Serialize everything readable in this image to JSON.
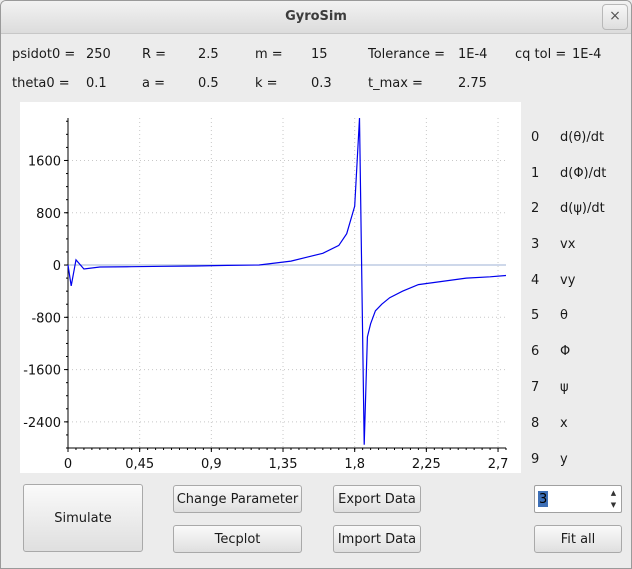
{
  "window": {
    "title": "GyroSim",
    "close_icon": "×"
  },
  "params": [
    {
      "label": "psidot0 =",
      "value": "250"
    },
    {
      "label": "R =",
      "value": "2.5"
    },
    {
      "label": "m =",
      "value": "15"
    },
    {
      "label": "Tolerance =",
      "value": "1E-4"
    },
    {
      "label": "cq tol =",
      "value": "1E-4"
    },
    {
      "label": "theta0 =",
      "value": "0.1"
    },
    {
      "label": "a =",
      "value": "0.5"
    },
    {
      "label": "k =",
      "value": "0.3"
    },
    {
      "label": "t_max =",
      "value": "2.75"
    }
  ],
  "channels": [
    {
      "num": "0",
      "name": "d(θ)/dt"
    },
    {
      "num": "1",
      "name": "d(Φ)/dt"
    },
    {
      "num": "2",
      "name": "d(ψ)/dt"
    },
    {
      "num": "3",
      "name": "vx"
    },
    {
      "num": "4",
      "name": "vy"
    },
    {
      "num": "5",
      "name": "θ"
    },
    {
      "num": "6",
      "name": "Φ"
    },
    {
      "num": "7",
      "name": "ψ"
    },
    {
      "num": "8",
      "name": "x"
    },
    {
      "num": "9",
      "name": "y"
    }
  ],
  "buttons": {
    "simulate": "Simulate",
    "change_parameter": "Change Parameter",
    "tecplot": "Tecplot",
    "export_data": "Export Data",
    "import_data": "Import Data",
    "fit_all": "Fit all"
  },
  "spinbox": {
    "value": "3"
  },
  "chart_data": {
    "type": "line",
    "title": "",
    "xlabel": "",
    "ylabel": "",
    "xlim": [
      0,
      2.75
    ],
    "ylim": [
      -2800,
      2250
    ],
    "x_ticks": [
      "0",
      "0,45",
      "0,9",
      "1,35",
      "1,8",
      "2,25",
      "2,7"
    ],
    "x_tick_values": [
      0,
      0.45,
      0.9,
      1.35,
      1.8,
      2.25,
      2.7
    ],
    "y_ticks": [
      "1600",
      "800",
      "0",
      "-800",
      "-1600",
      "-2400"
    ],
    "y_tick_values": [
      1600,
      800,
      0,
      -800,
      -1600,
      -2400
    ],
    "grid": true,
    "line_color": "#0000ee",
    "zero_line_color": "#9db2d6",
    "series": [
      {
        "x": [
          0,
          0.02,
          0.05,
          0.1,
          0.2,
          0.4,
          0.6,
          0.8,
          1.0,
          1.2,
          1.4,
          1.5,
          1.6,
          1.7,
          1.75,
          1.8,
          1.83,
          1.86,
          1.88,
          1.9,
          1.93,
          1.97,
          2.02,
          2.1,
          2.2,
          2.35,
          2.5,
          2.65,
          2.75
        ],
        "y": [
          0,
          -320,
          80,
          -60,
          -30,
          -25,
          -20,
          -15,
          -5,
          0,
          60,
          120,
          180,
          300,
          480,
          900,
          2250,
          -2750,
          -1100,
          -900,
          -700,
          -600,
          -500,
          -400,
          -300,
          -250,
          -200,
          -180,
          -160
        ]
      }
    ]
  }
}
